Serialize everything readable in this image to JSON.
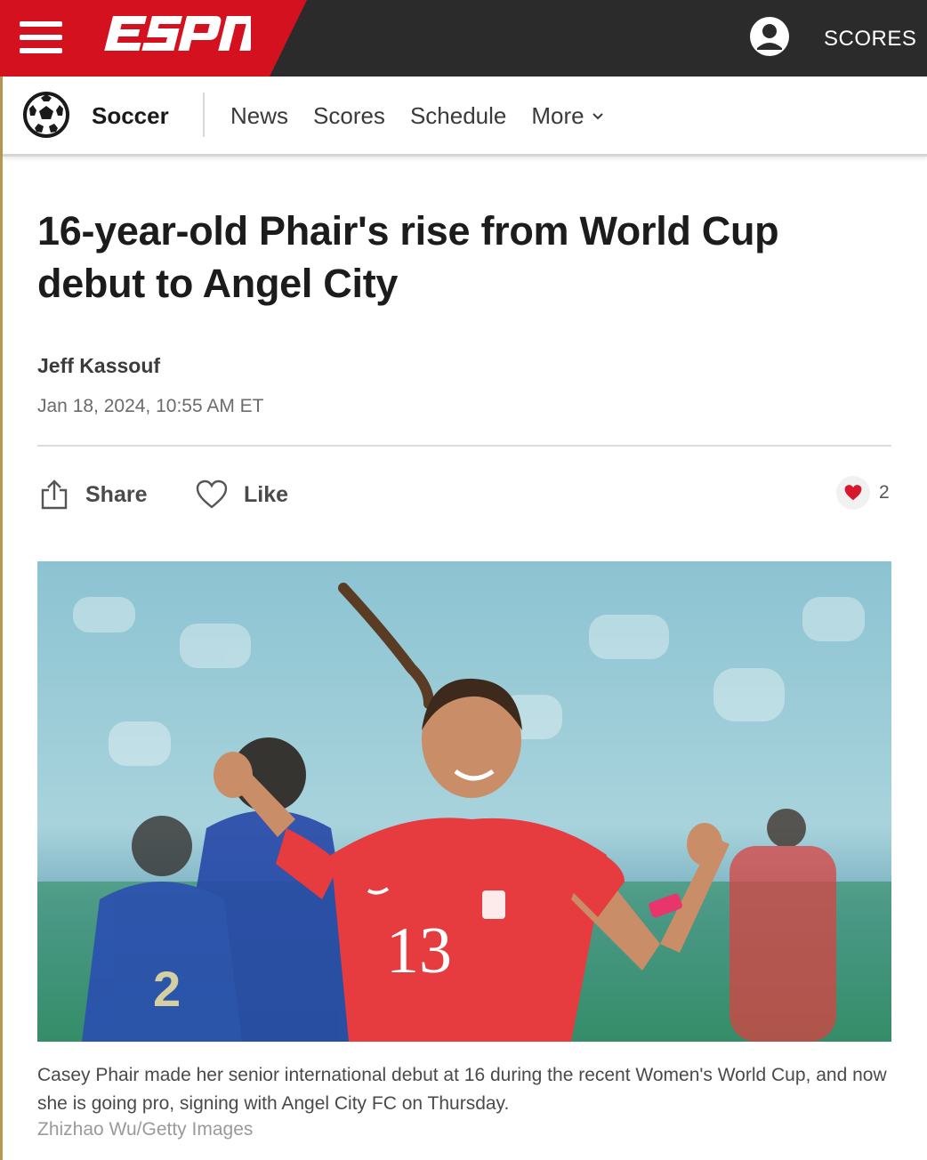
{
  "header": {
    "brand": "ESPN",
    "scores_label": "SCORES",
    "colors": {
      "brand_red": "#d4121f",
      "bar_dark": "#2b2b2b"
    }
  },
  "subnav": {
    "sport": "Soccer",
    "sport_icon": "soccer-ball-icon",
    "links": [
      "News",
      "Scores",
      "Schedule",
      "More"
    ]
  },
  "article": {
    "headline": "16-year-old Phair's rise from World Cup debut to Angel City",
    "author": "Jeff Kassouf",
    "timestamp": "Jan 18, 2024, 10:55 AM ET",
    "share_label": "Share",
    "like_label": "Like",
    "like_count": "2",
    "photo": {
      "caption": "Casey Phair made her senior international debut at 16 during the recent Women's World Cup, and now she is going pro, signing with Angel City FC on Thursday.",
      "credit": "Zhizhao Wu/Getty Images"
    }
  }
}
